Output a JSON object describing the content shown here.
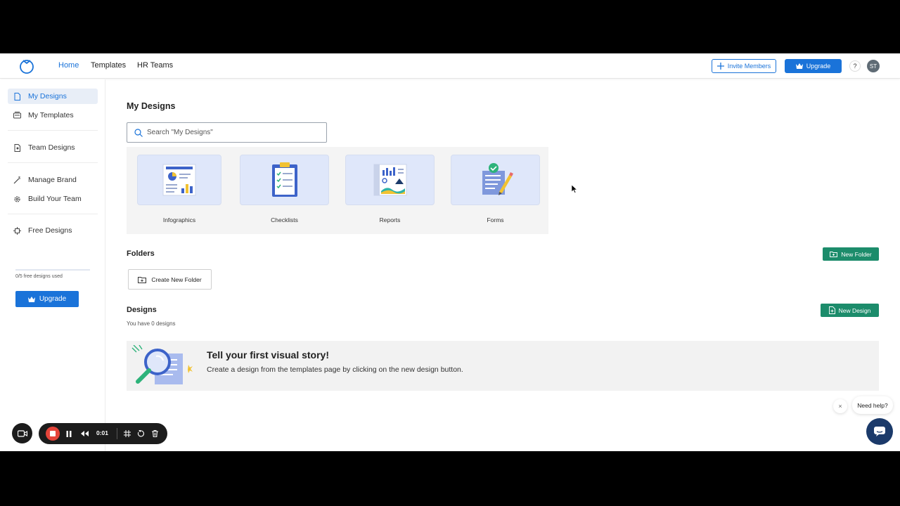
{
  "topnav": {
    "links": [
      "Home",
      "Templates",
      "HR Teams"
    ],
    "active": "Home",
    "invite_label": "Invite Members",
    "upgrade_label": "Upgrade",
    "help_label": "?",
    "avatar_initials": "ST"
  },
  "sidebar": {
    "items": [
      {
        "label": "My Designs",
        "icon": "document-icon"
      },
      {
        "label": "My Templates",
        "icon": "template-icon"
      },
      {
        "label": "Team Designs",
        "icon": "team-doc-icon"
      },
      {
        "label": "Manage Brand",
        "icon": "magic-wand-icon"
      },
      {
        "label": "Build Your Team",
        "icon": "gear-icon"
      },
      {
        "label": "Free Designs",
        "icon": "sparkle-icon"
      }
    ],
    "free_count": "0/5 free designs used",
    "free_progress": 0,
    "upgrade_label": "Upgrade"
  },
  "main": {
    "title": "My Designs",
    "search_placeholder": "Search \"My Designs\"",
    "categories": [
      {
        "label": "Infographics",
        "icon": "infographic-icon"
      },
      {
        "label": "Checklists",
        "icon": "checklist-icon"
      },
      {
        "label": "Reports",
        "icon": "report-icon"
      },
      {
        "label": "Forms",
        "icon": "form-icon"
      }
    ],
    "folders_title": "Folders",
    "new_folder_label": "New Folder",
    "create_folder_label": "Create New Folder",
    "designs_title": "Designs",
    "designs_count": "You have 0 designs",
    "new_design_label": "New Design",
    "empty_title": "Tell your first visual story!",
    "empty_desc": "Create a design from the templates page by clicking on the new design button."
  },
  "help": {
    "bubble": "Need help?",
    "close": "×"
  },
  "recorder": {
    "time": "0:01"
  },
  "colors": {
    "brand_blue": "#1a73d9",
    "green": "#1c8c6b",
    "chat_navy": "#1b3a6a",
    "record_red": "#e5443a"
  }
}
